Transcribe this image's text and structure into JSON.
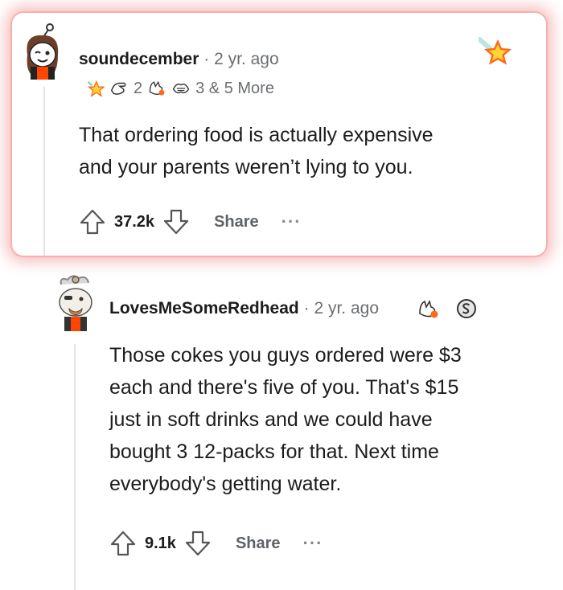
{
  "comment_main": {
    "username": "soundecember",
    "separator": "·",
    "age": "2 yr. ago",
    "award_count_1": "2",
    "award_more": "3 & 5 More",
    "body_line1": "That ordering food is actually expensive",
    "body_line2": "and your parents weren’t lying to you.",
    "votes": "37.2k",
    "share_label": "Share",
    "more_label": "···"
  },
  "reply": {
    "username": "LovesMeSomeRedhead",
    "separator": "·",
    "age": "2 yr. ago",
    "body_line1": "Those cokes you guys ordered were $3",
    "body_line2": "each and there's five of you. That's $15",
    "body_line3": "just in soft drinks and we could have",
    "body_line4": "bought 3 12-packs for that. Next time",
    "body_line5": "everybody's getting water.",
    "votes": "9.1k",
    "share_label": "Share",
    "more_label": "···"
  },
  "colors": {
    "highlight_glow": "#f07070",
    "text": "#1c1c1c",
    "meta": "#6b6e71",
    "share": "#5f6368",
    "thread_line": "#e4e4e4",
    "award_orange": "#ff6a1a",
    "award_yellow": "#ffd635"
  },
  "icons": [
    "avatar-snoo",
    "star-award-icon",
    "helpful-hand-icon",
    "wholesome-hug-icon",
    "upvote-icon",
    "downvote-icon",
    "silver-coin-icon"
  ]
}
